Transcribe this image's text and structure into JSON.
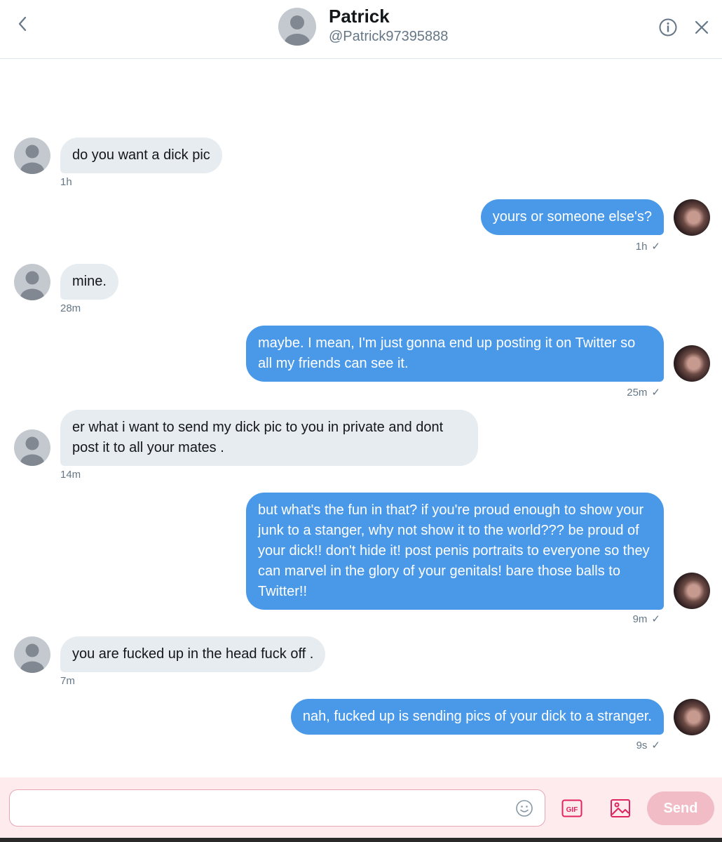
{
  "header": {
    "name": "Patrick",
    "handle": "@Patrick97395888",
    "back_icon": "chevron-left-icon",
    "info_icon": "info-icon",
    "close_icon": "close-icon"
  },
  "messages": [
    {
      "direction": "in",
      "text": "do you want a dick pic",
      "time": "1h"
    },
    {
      "direction": "out",
      "text": "yours or someone else's?",
      "time": "1h",
      "status": "✓"
    },
    {
      "direction": "in",
      "text": "mine.",
      "time": "28m"
    },
    {
      "direction": "out",
      "text": "maybe. I mean, I'm just gonna end up posting it on Twitter so all my friends can see it.",
      "time": "25m",
      "status": "✓"
    },
    {
      "direction": "in",
      "text": "er what i want to send my dick pic to you in private and dont post it to all your mates .",
      "time": "14m"
    },
    {
      "direction": "out",
      "text": "but what's the fun in that? if you're proud enough to show your junk to a stanger, why not show it to the world??? be proud of your dick!!  don't hide it! post penis portraits to everyone so they can marvel in the glory of your genitals!  bare those balls to Twitter!!",
      "time": "9m",
      "status": "✓"
    },
    {
      "direction": "in",
      "text": "you are fucked up in the head fuck off .",
      "time": "7m"
    },
    {
      "direction": "out",
      "text": "nah, fucked up is sending pics of your dick to a stranger.",
      "time": "9s",
      "status": "✓"
    }
  ],
  "composer": {
    "placeholder": "",
    "gif_label": "GIF",
    "send_label": "Send",
    "accent_color": "#e0245e"
  },
  "colors": {
    "outgoing_bubble": "#4a99e9",
    "incoming_bubble": "#e6ecf0",
    "composer_bg": "#fdebee"
  }
}
